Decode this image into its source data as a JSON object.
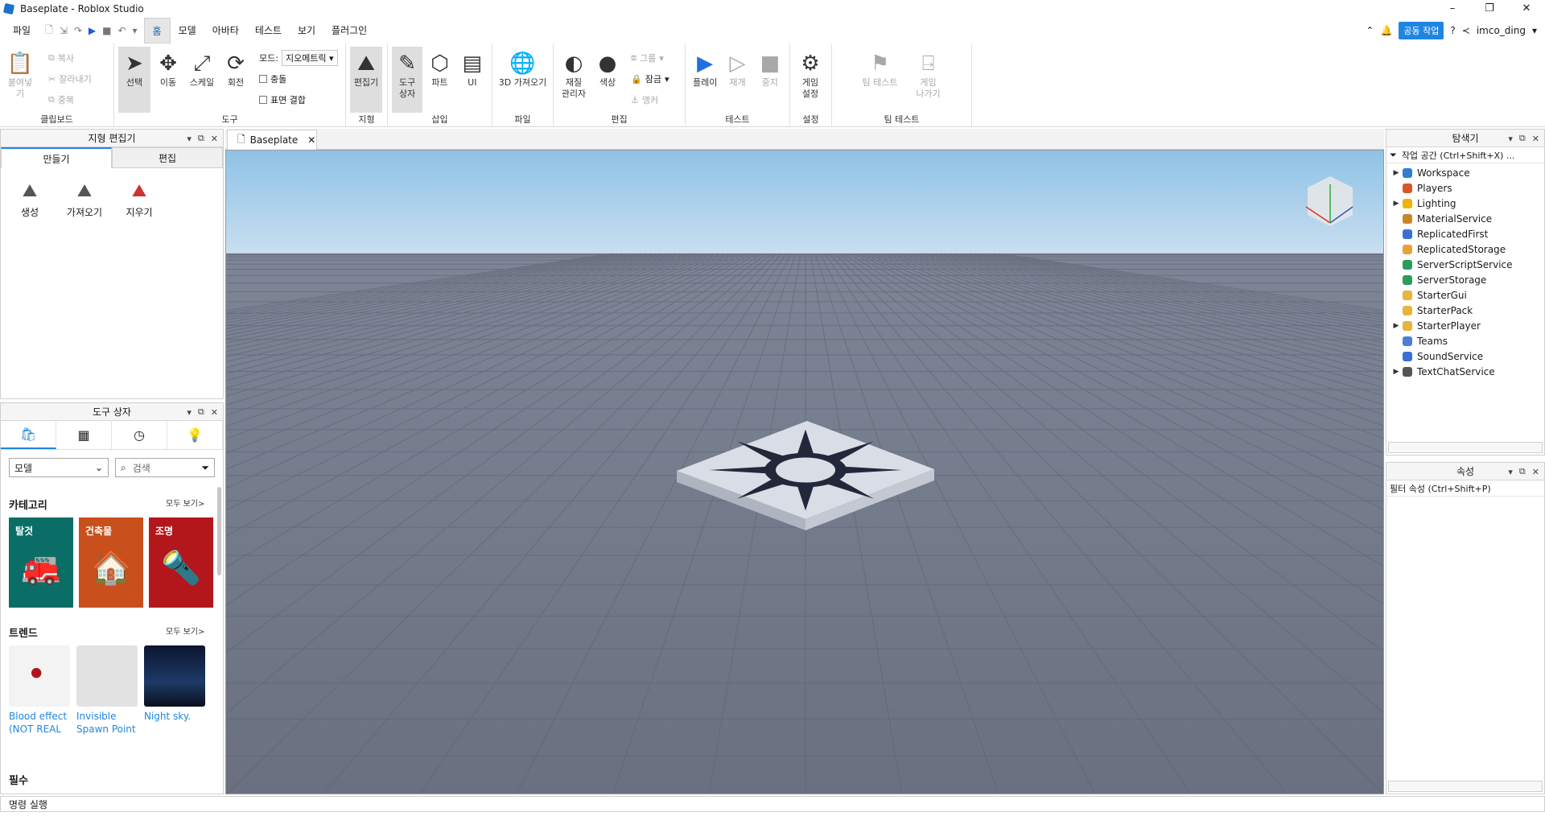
{
  "window": {
    "title": "Baseplate - Roblox Studio",
    "controls": [
      "–",
      "❐",
      "✕"
    ]
  },
  "menubar": {
    "items": [
      "파일",
      "홈",
      "모델",
      "아바타",
      "테스트",
      "보기",
      "플러그인"
    ],
    "collab_label": "공동 작업",
    "username": "imco_ding"
  },
  "ribbon": {
    "clipboard": {
      "paste": "붙여넣기",
      "copy": "복사",
      "cut": "잘라내기",
      "duplicate": "중복",
      "group": "클립보드"
    },
    "tools": {
      "select": "선택",
      "move": "이동",
      "scale": "스케일",
      "rotate": "회전",
      "mode_label": "모드:",
      "mode_value": "지오메트릭",
      "collision": "충돌",
      "surface_join": "표면 결합",
      "group": "도구"
    },
    "terrain": {
      "editor": "편집기",
      "group": "지형"
    },
    "insert": {
      "toolbox_line1": "도구",
      "toolbox_line2": "상자",
      "part": "파트",
      "ui": "UI",
      "group": "삽입"
    },
    "file": {
      "import3d": "3D 가져오기",
      "group": "파일"
    },
    "edit": {
      "material_line1": "재질",
      "material_line2": "관리자",
      "color": "색상",
      "group_btn": "그룹",
      "lock": "잠금",
      "anchor": "앵커",
      "group": "편집"
    },
    "test": {
      "play": "플레이",
      "resume": "재개",
      "stop": "중지",
      "group": "테스트"
    },
    "settings": {
      "line1": "게임",
      "line2": "설정",
      "group": "설정"
    },
    "teamtest": {
      "team_test": "팀 테스트",
      "exit_line1": "게임",
      "exit_line2": "나가기",
      "group": "팀 테스트"
    }
  },
  "terrain_panel": {
    "title": "지형 편집기",
    "tab_create": "만들기",
    "tab_edit": "편집",
    "tools": [
      "생성",
      "가져오기",
      "지우기"
    ]
  },
  "toolbox": {
    "title": "도구 상자",
    "dropdown": "모델",
    "search_placeholder": "검색",
    "categories_title": "카테고리",
    "see_all": "모두 보기>",
    "categories": [
      {
        "label": "탈것",
        "color": "#0b6e66"
      },
      {
        "label": "건축물",
        "color": "#c9501c"
      },
      {
        "label": "조명",
        "color": "#b3171b"
      }
    ],
    "trending_title": "트렌드",
    "trending": [
      {
        "line1": "Blood effect",
        "line2": "(NOT REAL"
      },
      {
        "line1": "Invisible",
        "line2": "Spawn Point"
      },
      {
        "line1": "Night sky.",
        "line2": ""
      }
    ],
    "essentials_title": "필수"
  },
  "document_tab": {
    "label": "Baseplate"
  },
  "explorer": {
    "title": "탐색기",
    "filter": "작업 공간 (Ctrl+Shift+X) ...",
    "items": [
      {
        "label": "Workspace",
        "expandable": true,
        "color": "#2f7dd1"
      },
      {
        "label": "Players",
        "expandable": false,
        "color": "#d9552b"
      },
      {
        "label": "Lighting",
        "expandable": true,
        "color": "#f0b400"
      },
      {
        "label": "MaterialService",
        "expandable": false,
        "color": "#c8862a"
      },
      {
        "label": "ReplicatedFirst",
        "expandable": false,
        "color": "#3a6fd8"
      },
      {
        "label": "ReplicatedStorage",
        "expandable": false,
        "color": "#e8a23a"
      },
      {
        "label": "ServerScriptService",
        "expandable": false,
        "color": "#2a9d5c"
      },
      {
        "label": "ServerStorage",
        "expandable": false,
        "color": "#2a9d5c"
      },
      {
        "label": "StarterGui",
        "expandable": false,
        "color": "#e8b43a"
      },
      {
        "label": "StarterPack",
        "expandable": false,
        "color": "#e8b43a"
      },
      {
        "label": "StarterPlayer",
        "expandable": true,
        "color": "#e8b43a"
      },
      {
        "label": "Teams",
        "expandable": false,
        "color": "#4a7fd8"
      },
      {
        "label": "SoundService",
        "expandable": false,
        "color": "#3a6fd8"
      },
      {
        "label": "TextChatService",
        "expandable": true,
        "color": "#555555"
      }
    ]
  },
  "properties": {
    "title": "속성",
    "filter": "필터 속성 (Ctrl+Shift+P)"
  },
  "command_bar": {
    "placeholder": "명령 실행"
  }
}
